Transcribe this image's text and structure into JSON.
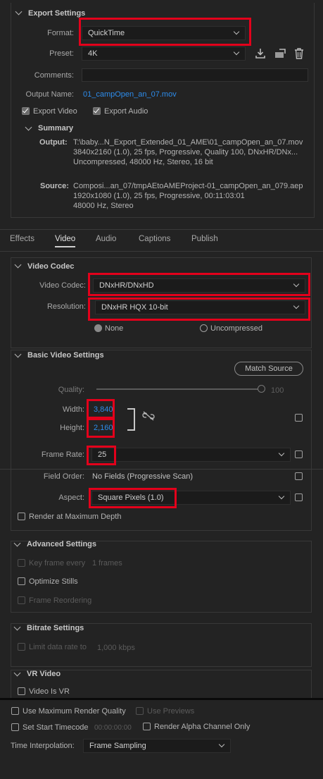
{
  "export": {
    "title": "Export Settings",
    "format_label": "Format:",
    "format_value": "QuickTime",
    "preset_label": "Preset:",
    "preset_value": "4K",
    "comments_label": "Comments:",
    "output_name_label": "Output Name:",
    "output_name_value": "01_campOpen_an_07.mov",
    "export_video_label": "Export Video",
    "export_audio_label": "Export Audio"
  },
  "summary": {
    "title": "Summary",
    "output_label": "Output:",
    "output_lines": [
      "T:\\baby...N_Export_Extended_01_AME\\01_campOpen_an_07.mov",
      "3840x2160 (1.0), 25 fps, Progressive, Quality 100, DNxHR/DNx...",
      "Uncompressed, 48000 Hz, Stereo, 16 bit"
    ],
    "source_label": "Source:",
    "source_lines": [
      "Composi...an_07/tmpAEtoAMEProject-01_campOpen_an_079.aep",
      "1920x1080 (1.0), 25 fps, Progressive, 00:11:03:01",
      "48000 Hz, Stereo"
    ]
  },
  "tabs": [
    "Effects",
    "Video",
    "Audio",
    "Captions",
    "Publish"
  ],
  "video_codec": {
    "title": "Video Codec",
    "codec_label": "Video Codec:",
    "codec_value": "DNxHR/DNxHD",
    "resolution_label": "Resolution:",
    "resolution_value": "DNxHR HQX 10-bit",
    "none_label": "None",
    "uncompressed_label": "Uncompressed"
  },
  "basic_video": {
    "title": "Basic Video Settings",
    "match_source": "Match Source",
    "quality_label": "Quality:",
    "quality_value": "100",
    "quality_level": 1.0,
    "width_label": "Width:",
    "width_value": "3,840",
    "height_label": "Height:",
    "height_value": "2,160",
    "frame_rate_label": "Frame Rate:",
    "frame_rate_value": "25",
    "field_order_label": "Field Order:",
    "field_order_value": "No Fields (Progressive Scan)",
    "aspect_label": "Aspect:",
    "aspect_value": "Square Pixels (1.0)",
    "render_max_depth": "Render at Maximum Depth"
  },
  "advanced": {
    "title": "Advanced Settings",
    "key_frame_label": "Key frame every",
    "key_frame_value": "1 frames",
    "optimize_stills": "Optimize Stills",
    "frame_reordering": "Frame Reordering"
  },
  "bitrate": {
    "title": "Bitrate Settings",
    "limit_label": "Limit data rate to",
    "limit_value": "1,000 kbps"
  },
  "vr": {
    "title": "VR Video",
    "is_vr": "Video Is VR"
  },
  "bottom": {
    "max_render_quality": "Use Maximum Render Quality",
    "use_previews": "Use Previews",
    "set_start_tc": "Set Start Timecode",
    "start_tc_value": "00:00:00:00",
    "render_alpha": "Render Alpha Channel Only",
    "time_interp_label": "Time Interpolation:",
    "time_interp_value": "Frame Sampling"
  },
  "colors": {
    "accent_blue": "#2d8ceb",
    "highlight_red": "#e3001b",
    "bg": "#232323"
  }
}
